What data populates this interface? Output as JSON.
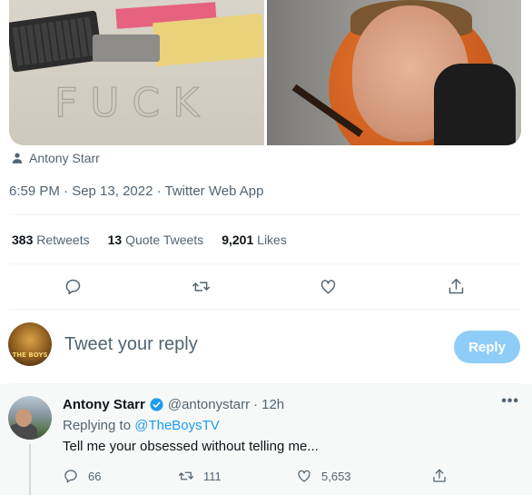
{
  "media": {
    "left_image": "desk-photo",
    "right_image": "basketball-face-photo"
  },
  "author_line": {
    "icon": "person-icon",
    "name": "Antony Starr"
  },
  "timestamp": {
    "text": "6:59 PM · Sep 13, 2022 · Twitter Web App"
  },
  "stats": {
    "retweets_count": "383",
    "retweets_label": "Retweets",
    "quotes_count": "13",
    "quotes_label": "Quote Tweets",
    "likes_count": "9,201",
    "likes_label": "Likes"
  },
  "actions": [
    "reply-icon",
    "retweet-icon",
    "like-icon",
    "share-icon"
  ],
  "reply_box": {
    "placeholder": "Tweet your reply",
    "button_label": "Reply",
    "button_color": "#8ecdf8"
  },
  "reply_tweet": {
    "name": "Antony Starr",
    "handle": "@antonystarr",
    "dot": "·",
    "time": "12h",
    "more": "•••",
    "replying_prefix": "Replying to",
    "replying_handle": "@TheBoysTV",
    "text": "Tell me your obsessed without telling me...",
    "reply_count": "66",
    "retweet_count": "111",
    "like_count": "5,653"
  },
  "colors": {
    "accent": "#1d9bf0",
    "muted": "#536471",
    "text": "#0f1419"
  }
}
